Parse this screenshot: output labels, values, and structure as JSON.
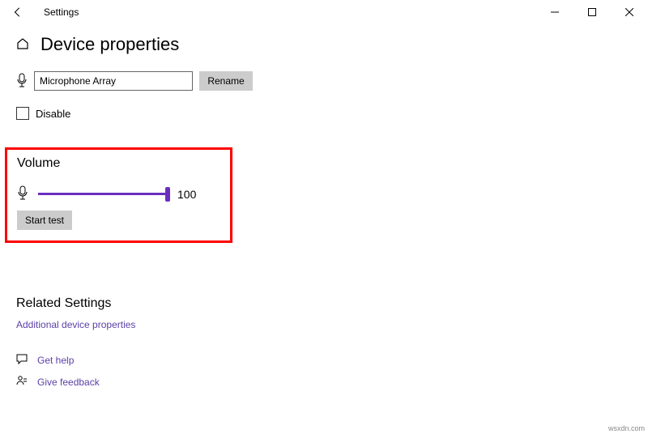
{
  "window": {
    "title": "Settings"
  },
  "page": {
    "title": "Device properties"
  },
  "device": {
    "name": "Microphone Array",
    "rename_label": "Rename",
    "disable_label": "Disable"
  },
  "volume": {
    "heading": "Volume",
    "value": "100",
    "start_test_label": "Start test"
  },
  "related": {
    "heading": "Related Settings",
    "additional_link": "Additional device properties"
  },
  "help": {
    "get_help": "Get help",
    "give_feedback": "Give feedback"
  },
  "watermark": "wsxdn.com"
}
